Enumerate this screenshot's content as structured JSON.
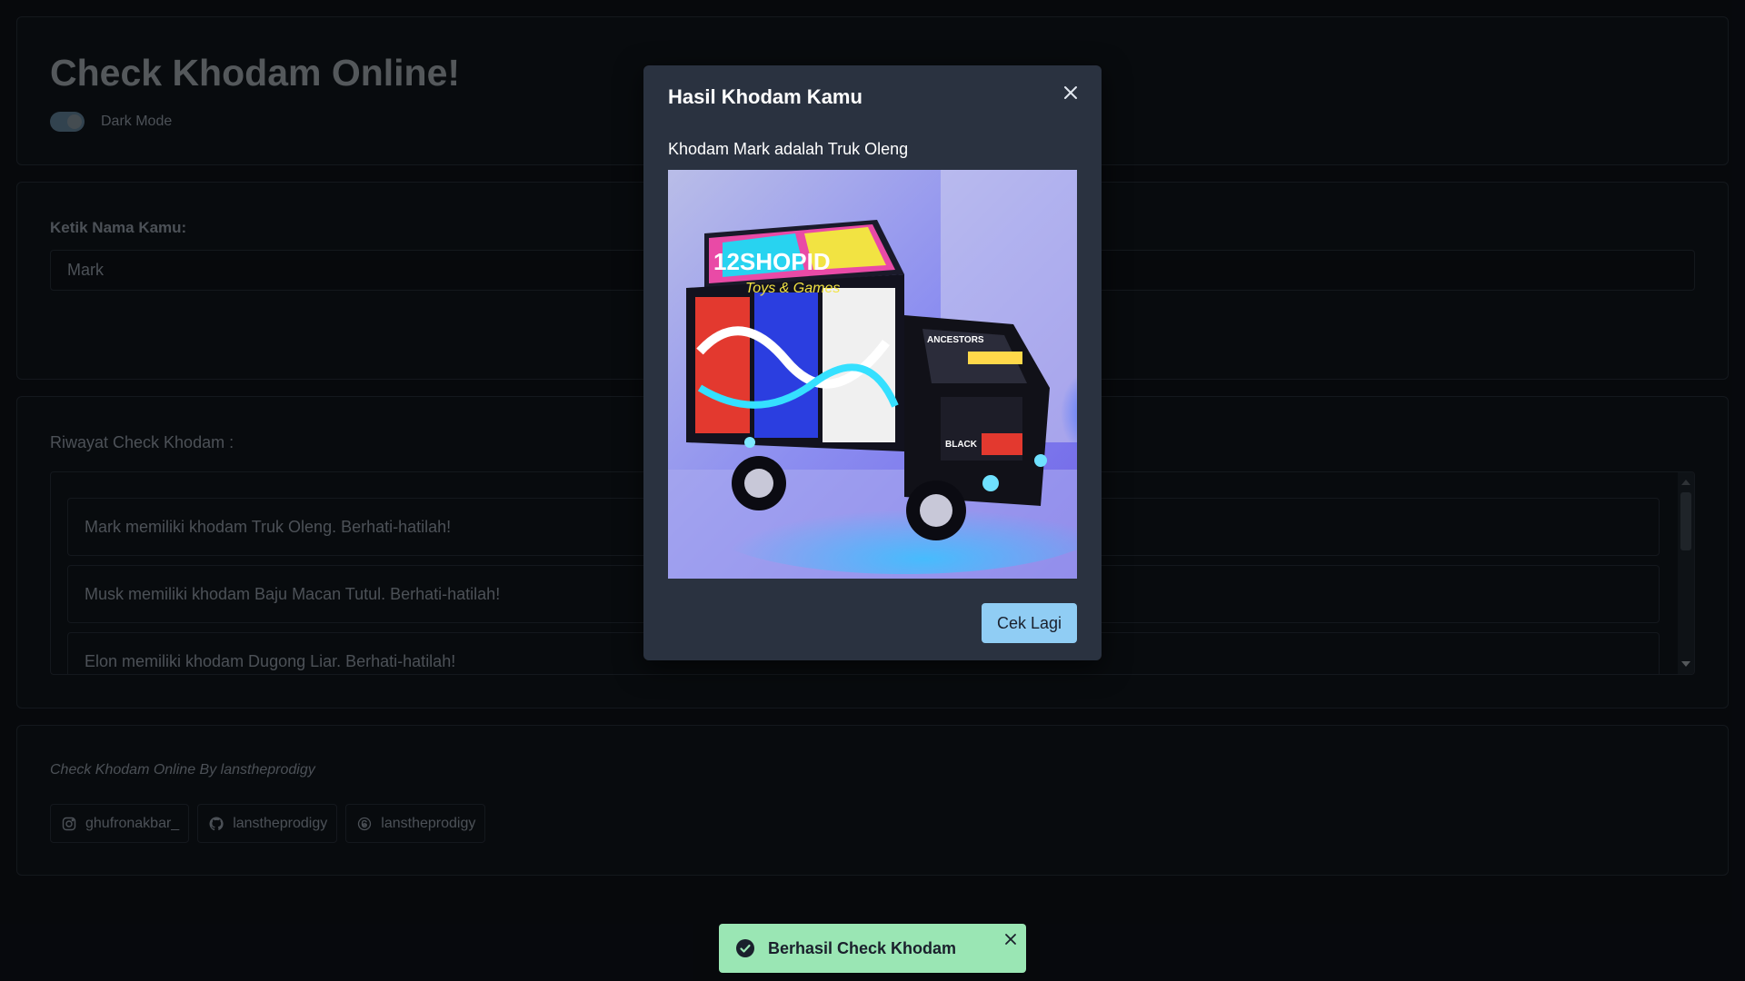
{
  "header": {
    "title": "Check Khodam Online!",
    "dark_mode_label": "Dark Mode",
    "dark_mode_on": true
  },
  "form": {
    "label": "Ketik Nama Kamu:",
    "name_value": "Mark"
  },
  "history": {
    "label": "Riwayat Check Khodam :",
    "items": [
      "Mark memiliki khodam Truk Oleng. Berhati-hatilah!",
      "Musk memiliki khodam Baju Macan Tutul. Berhati-hatilah!",
      "Elon memiliki khodam Dugong Liar. Berhati-hatilah!"
    ]
  },
  "footer": {
    "credit": "Check Khodam Online By lanstheprodigy",
    "socials": [
      {
        "icon": "instagram-icon",
        "label": "ghufronakbar_"
      },
      {
        "icon": "github-icon",
        "label": "lanstheprodigy"
      },
      {
        "icon": "threads-icon",
        "label": "lanstheprodigy"
      }
    ]
  },
  "modal": {
    "title": "Hasil Khodam Kamu",
    "result_text": "Khodam Mark adalah Truk Oleng",
    "image_subject": "Truk Oleng",
    "image_texts": [
      "12SHOPID",
      "Toys & Games",
      "ANCESTORS",
      "BLACK"
    ],
    "button_label": "Cek Lagi"
  },
  "toast": {
    "message": "Berhasil Check Khodam",
    "color": "#9ae6b4"
  },
  "colors": {
    "background": "#0d1117",
    "accent_button": "#90cdf4"
  }
}
